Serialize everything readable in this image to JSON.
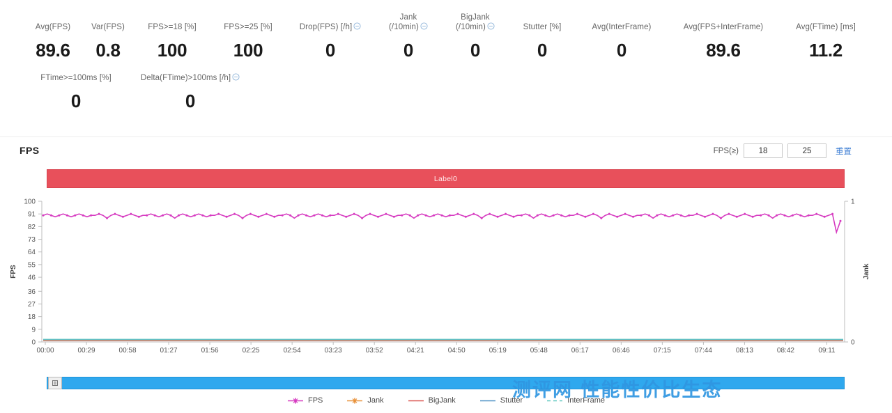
{
  "metrics": {
    "row1": [
      {
        "label": "Avg(FPS)",
        "value": "89.6",
        "info": false,
        "width": 84
      },
      {
        "label": "Var(FPS)",
        "value": "0.8",
        "info": false,
        "width": 74
      },
      {
        "label": "FPS>=18 [%]",
        "value": "100",
        "info": false,
        "width": 110
      },
      {
        "label": "FPS>=25 [%]",
        "value": "100",
        "info": false,
        "width": 108
      },
      {
        "label": "Drop(FPS) [/h]",
        "value": "0",
        "info": true,
        "width": 128
      },
      {
        "label": "Jank\n(/10min)",
        "value": "0",
        "info": true,
        "width": 96
      },
      {
        "label": "BigJank\n(/10min)",
        "value": "0",
        "info": true,
        "width": 96
      },
      {
        "label": "Stutter [%]",
        "value": "0",
        "info": false,
        "width": 96
      },
      {
        "label": "Avg(InterFrame)",
        "value": "0",
        "info": false,
        "width": 132
      },
      {
        "label": "Avg(FPS+InterFrame)",
        "value": "89.6",
        "info": false,
        "width": 160
      },
      {
        "label": "Avg(FTime) [ms]",
        "value": "11.2",
        "info": false,
        "width": 134
      }
    ],
    "row2": [
      {
        "label": "FTime>=100ms [%]",
        "value": "0",
        "info": false,
        "width": 142
      },
      {
        "label": "Delta(FTime)>100ms [/h]",
        "value": "0",
        "info": true,
        "width": 186
      }
    ]
  },
  "chart_header": {
    "title": "FPS",
    "threshold_label": "FPS(≥)",
    "threshold_low": "18",
    "threshold_high": "25",
    "reset_label": "重置"
  },
  "label_banner": {
    "text": "Label0",
    "color": "#e8505b"
  },
  "scrollbar": {
    "color": "#2fa8ee",
    "handle_icon": "drag-handle-icon"
  },
  "legend": [
    {
      "name": "FPS",
      "color": "#d63ac0",
      "style": "marker-line"
    },
    {
      "name": "Jank",
      "color": "#e8913a",
      "style": "marker-line"
    },
    {
      "name": "BigJank",
      "color": "#d9534f",
      "style": "line"
    },
    {
      "name": "Stutter",
      "color": "#4a90c4",
      "style": "line"
    },
    {
      "name": "InterFrame",
      "color": "#5ec8c0",
      "style": "dashed"
    }
  ],
  "watermark": {
    "text": "测评网 性能性价比生态"
  },
  "chart_data": {
    "type": "line",
    "title": "FPS",
    "xlabel": "",
    "ylabel": "FPS",
    "y2label": "Jank",
    "ylim": [
      0,
      100
    ],
    "y2lim": [
      0,
      1
    ],
    "grid": false,
    "legend_position": "bottom",
    "yticks": [
      0,
      9,
      18,
      27,
      36,
      46,
      55,
      64,
      73,
      82,
      91,
      100
    ],
    "y2ticks": [
      0,
      1
    ],
    "xticks": [
      "00:00",
      "00:29",
      "00:58",
      "01:27",
      "01:56",
      "02:25",
      "02:54",
      "03:23",
      "03:52",
      "04:21",
      "04:50",
      "05:19",
      "05:48",
      "06:17",
      "06:46",
      "07:15",
      "07:44",
      "08:13",
      "08:42",
      "09:11"
    ],
    "series": [
      {
        "name": "FPS",
        "color": "#d63ac0",
        "axis": "left",
        "mean": 89.6,
        "values": [
          90,
          91,
          90,
          89,
          90,
          91,
          90,
          89,
          90,
          91,
          90,
          89,
          90,
          90,
          91,
          90,
          88,
          90,
          91,
          90,
          89,
          90,
          91,
          90,
          89,
          90,
          90,
          91,
          90,
          89,
          90,
          91,
          90,
          88,
          90,
          91,
          90,
          89,
          90,
          91,
          90,
          89,
          90,
          90,
          91,
          90,
          89,
          90,
          91,
          90,
          88,
          90,
          91,
          90,
          89,
          90,
          91,
          90,
          89,
          90,
          90,
          91,
          90,
          88,
          90,
          91,
          90,
          89,
          90,
          91,
          90,
          89,
          90,
          90,
          91,
          90,
          89,
          90,
          91,
          90,
          88,
          90,
          91,
          90,
          89,
          90,
          91,
          90,
          89,
          90,
          90,
          91,
          90,
          88,
          90,
          91,
          90,
          89,
          90,
          91,
          90,
          89,
          90,
          90,
          91,
          90,
          89,
          90,
          91,
          90,
          88,
          90,
          91,
          90,
          89,
          90,
          91,
          90,
          89,
          90,
          90,
          91,
          90,
          88,
          90,
          91,
          90,
          89,
          90,
          91,
          90,
          89,
          90,
          90,
          91,
          90,
          89,
          90,
          91,
          90,
          88,
          90,
          91,
          90,
          89,
          90,
          91,
          90,
          89,
          90,
          90,
          91,
          90,
          88,
          90,
          91,
          90,
          89,
          90,
          91,
          90,
          89,
          90,
          90,
          91,
          90,
          89,
          90,
          91,
          90,
          88,
          90,
          91,
          90,
          89,
          90,
          91,
          90,
          89,
          90,
          90,
          91,
          90,
          88,
          90,
          91,
          90,
          89,
          90,
          91,
          90,
          89,
          90,
          90,
          91,
          90,
          89,
          90,
          91,
          78,
          86
        ]
      },
      {
        "name": "Jank",
        "color": "#e8913a",
        "axis": "right",
        "constant": 0
      },
      {
        "name": "BigJank",
        "color": "#d9534f",
        "axis": "right",
        "constant": 0
      },
      {
        "name": "Stutter",
        "color": "#4a90c4",
        "axis": "right",
        "constant": 0
      },
      {
        "name": "InterFrame",
        "color": "#5ec8c0",
        "axis": "right",
        "constant": 0
      }
    ]
  }
}
